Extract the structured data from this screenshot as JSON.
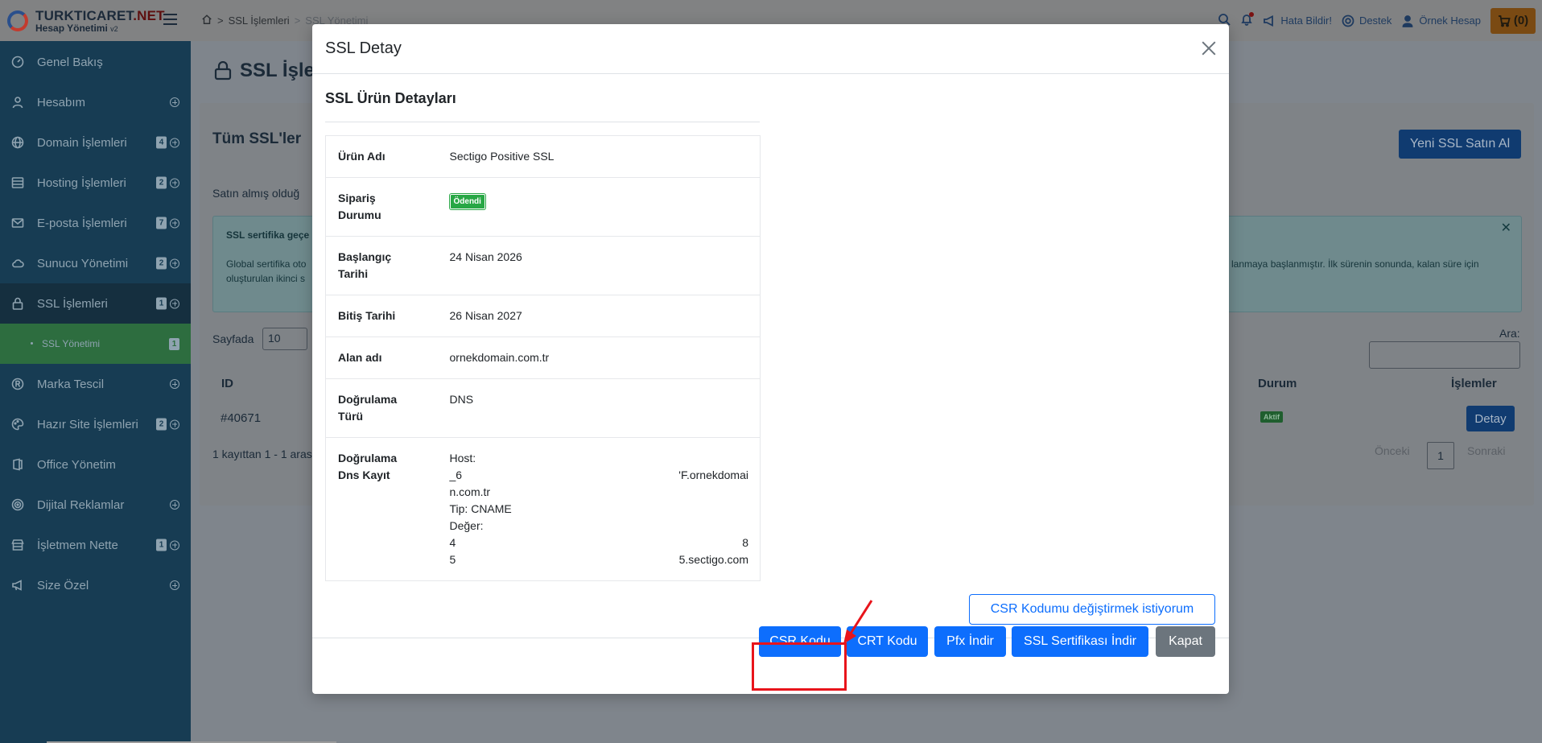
{
  "brand": {
    "name_part1": "TURKTICARET",
    "name_part2": ".NET",
    "subtitle": "Hesap Yönetimi",
    "version": "v2"
  },
  "sidebar": {
    "items": [
      {
        "label": "Genel Bakış",
        "icon": "dashboard-icon",
        "badge": "",
        "expandable": false
      },
      {
        "label": "Hesabım",
        "icon": "user-icon",
        "badge": "",
        "expandable": true
      },
      {
        "label": "Domain İşlemleri",
        "icon": "globe-icon",
        "badge": "4",
        "expandable": true
      },
      {
        "label": "Hosting İşlemleri",
        "icon": "server-icon",
        "badge": "2",
        "expandable": true
      },
      {
        "label": "E-posta İşlemleri",
        "icon": "mail-icon",
        "badge": "7",
        "expandable": true
      },
      {
        "label": "Sunucu Yönetimi",
        "icon": "cloud-icon",
        "badge": "2",
        "expandable": true
      },
      {
        "label": "SSL İşlemleri",
        "icon": "lock-icon",
        "badge": "1",
        "expandable": true
      },
      {
        "label": "Marka Tescil",
        "icon": "registered-icon",
        "badge": "",
        "expandable": true
      },
      {
        "label": "Hazır Site İşlemleri",
        "icon": "palette-icon",
        "badge": "2",
        "expandable": true
      },
      {
        "label": "Office Yönetim",
        "icon": "office-icon",
        "badge": "",
        "expandable": false
      },
      {
        "label": "Dijital Reklamlar",
        "icon": "target-icon",
        "badge": "",
        "expandable": true
      },
      {
        "label": "İşletmem Nette",
        "icon": "store-icon",
        "badge": "1",
        "expandable": true
      },
      {
        "label": "Size Özel",
        "icon": "megaphone-icon",
        "badge": "",
        "expandable": true
      }
    ],
    "sub_item": {
      "label": "SSL Yönetimi",
      "badge": "1"
    }
  },
  "topbar": {
    "breadcrumb": [
      "SSL İşlemleri",
      "SSL Yönetimi"
    ],
    "report_error": "Hata Bildir!",
    "support": "Destek",
    "account": "Örnek Hesap",
    "cart": "(0)"
  },
  "background": {
    "page_title": "SSL İşle",
    "card_title": "Tüm SSL'ler",
    "new_ssl_button": "Yeni SSL Satın Al",
    "intro_text": "Satın almış olduğ",
    "alert_title": "SSL sertifika geçe",
    "alert_line1": "Global sertifika oto",
    "alert_line2": "oluşturulan ikinci s",
    "alert_right": "lanmaya başlanmıştır. İlk sürenin sonunda, kalan süre için",
    "per_page_label": "Sayfada",
    "per_page_value": "10",
    "search_label": "Ara:",
    "col_id": "ID",
    "col_status": "Durum",
    "col_actions": "İşlemler",
    "row_id": "#40671",
    "row_status": "Aktif",
    "row_detail": "Detay",
    "records_text": "1 kayıttan 1 - 1 aras",
    "prev": "Önceki",
    "page": "1",
    "next": "Sonraki"
  },
  "modal": {
    "title": "SSL Detay",
    "section_title": "SSL Ürün Detayları",
    "rows": {
      "product_label": "Ürün Adı",
      "product_value": "Sectigo Positive SSL",
      "order_label_1": "Sipariş",
      "order_label_2": "Durumu",
      "order_value": "Ödendi",
      "start_label_1": "Başlangıç",
      "start_label_2": "Tarihi",
      "start_value": "24 Nisan 2026",
      "end_label": "Bitiş Tarihi",
      "end_value": "26 Nisan 2027",
      "domain_label": "Alan adı",
      "domain_value": "ornekdomain.com.tr",
      "validation_label_1": "Doğrulama",
      "validation_label_2": "Türü",
      "validation_value": "DNS",
      "dns_label_1": "Doğrulama",
      "dns_label_2": "Dns Kayıt",
      "dns_host": "Host:",
      "dns_host_start": "_6",
      "dns_host_end": "'F.ornekdomai",
      "dns_host_cont": "n.com.tr",
      "dns_type": "Tip: CNAME",
      "dns_value_label": "Değer:",
      "dns_value_start": "4",
      "dns_value_end": "8",
      "dns_value2_start": "5",
      "dns_value2_end": "5.sectigo.com"
    },
    "csr_change_button": "CSR Kodumu değiştirmek istiyorum",
    "buttons": {
      "csr": "CSR Kodu",
      "crt": "CRT Kodu",
      "pfx": "Pfx İndir",
      "ssl_download": "SSL Sertifikası İndir",
      "close": "Kapat"
    }
  },
  "colors": {
    "primary": "#0d6efd",
    "secondary": "#6c757d",
    "success": "#28a745",
    "highlight": "#e8141b",
    "sidebar": "#173c53"
  }
}
